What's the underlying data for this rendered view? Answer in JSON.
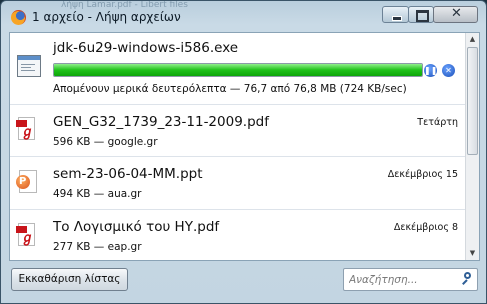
{
  "window": {
    "title": "1 αρχείο - Λήψη αρχείων",
    "bg_strip": "λήψη Lamar.pdf - Libert files"
  },
  "downloads": [
    {
      "name": "jdk-6u29-windows-i586.exe",
      "status": "Απομένουν μερικά δευτερόλεπτα — 76,7 από 76,8 MB (724 KB/sec)",
      "progress_percent": 99.9,
      "icon": "exe-icon",
      "pause_symbol": "❚❚",
      "cancel_symbol": "✕"
    },
    {
      "name": "GEN_G32_1739_23-11-2009.pdf",
      "meta": "596 KB — google.gr",
      "when": "Τετάρτη",
      "icon": "pdf-icon"
    },
    {
      "name": "sem-23-06-04-MM.ppt",
      "meta": "494 KB — aua.gr",
      "when": "Δεκέμβριος 15",
      "icon": "ppt-icon"
    },
    {
      "name": "Το Λογισμικό του ΗΥ.pdf",
      "meta": "277 KB — eap.gr",
      "when": "Δεκέμβριος 8",
      "icon": "pdf-icon"
    }
  ],
  "footer": {
    "clear_label": "Εκκαθάριση λίστας",
    "search_placeholder": "Αναζήτηση..."
  },
  "colors": {
    "progress_green": "#20c21a",
    "pdf_red": "#c8141a",
    "control_blue": "#1a4fb8"
  }
}
